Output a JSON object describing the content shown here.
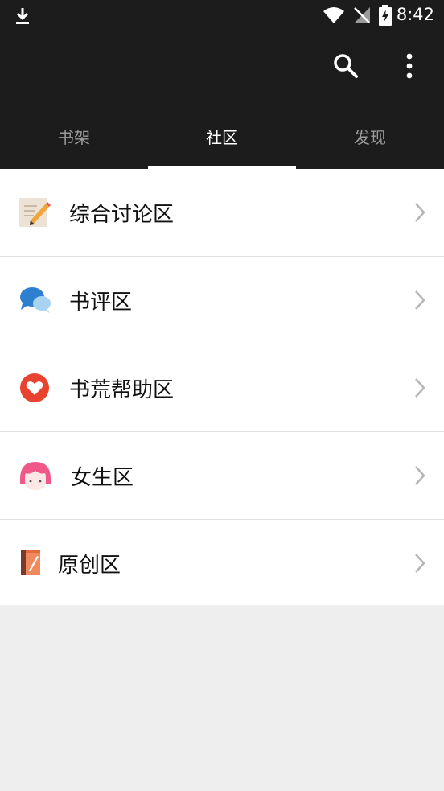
{
  "status": {
    "time": "8:42"
  },
  "tabs": [
    {
      "label": "书架",
      "active": false
    },
    {
      "label": "社区",
      "active": true
    },
    {
      "label": "发现",
      "active": false
    }
  ],
  "rows": [
    {
      "label": "综合讨论区",
      "icon": "notepad-pencil-icon"
    },
    {
      "label": "书评区",
      "icon": "chat-bubbles-icon"
    },
    {
      "label": "书荒帮助区",
      "icon": "heart-icon"
    },
    {
      "label": "女生区",
      "icon": "girl-face-icon"
    },
    {
      "label": "原创区",
      "icon": "book-pen-icon"
    }
  ],
  "colors": {
    "appbar": "#1c1c1c",
    "accent_blue": "#2f7fd1",
    "heart_red": "#e8432e",
    "pink": "#f0588a"
  }
}
